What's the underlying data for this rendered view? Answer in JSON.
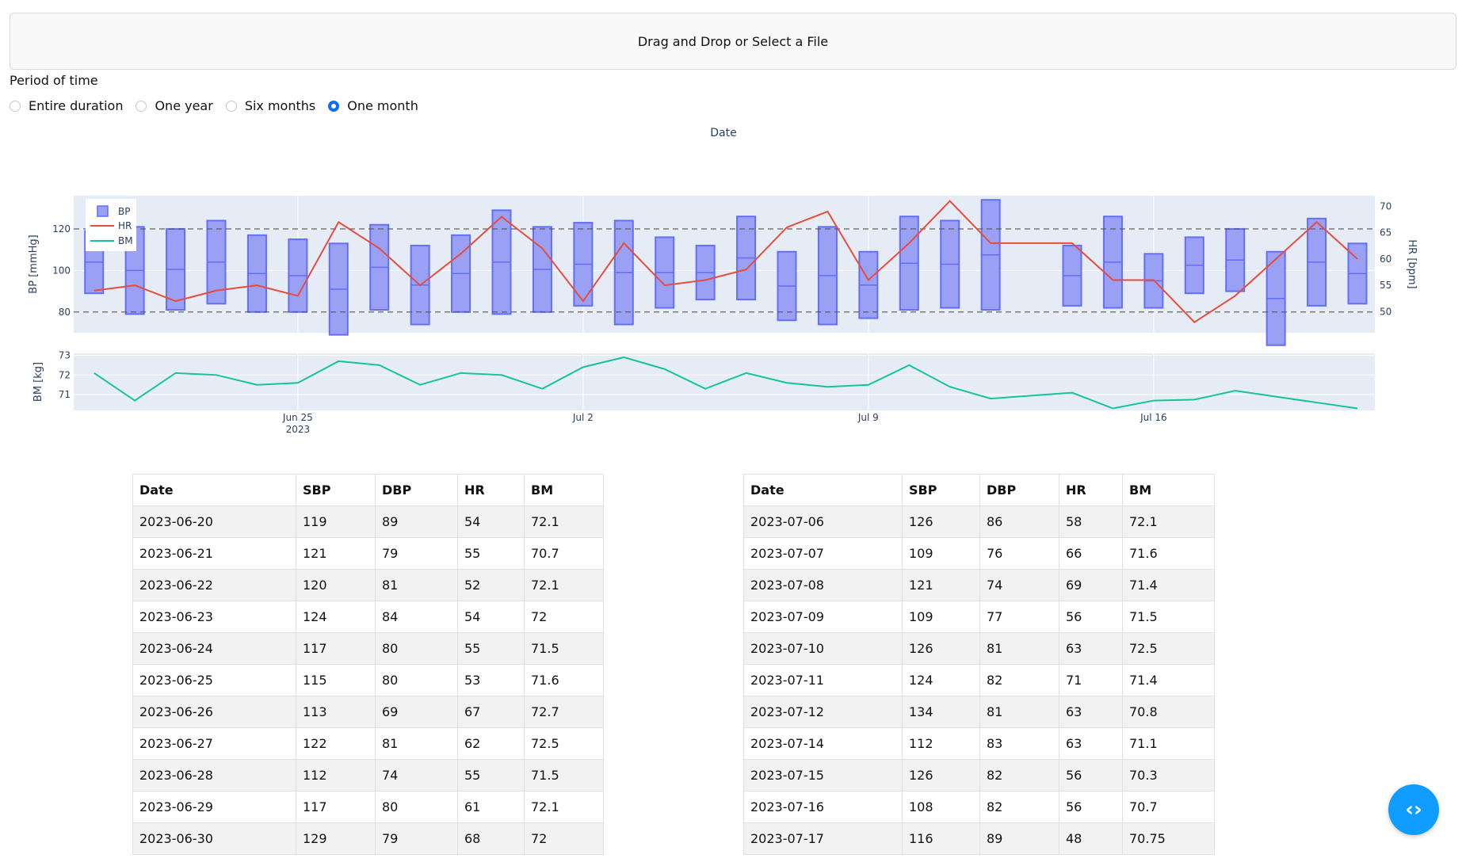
{
  "upload": {
    "label": "Drag and Drop or Select a File"
  },
  "period": {
    "label": "Period of time",
    "options": [
      "Entire duration",
      "One year",
      "Six months",
      "One month"
    ],
    "selected": "One month"
  },
  "chart_data": {
    "type": "mixed",
    "title": "Date",
    "legend": {
      "entries": [
        "BP",
        "HR",
        "BM"
      ],
      "placement": "top-left"
    },
    "top_panel": {
      "y_left": {
        "label": "BP [mmHg]",
        "range": [
          70,
          136
        ],
        "ticks": [
          80,
          100,
          120
        ]
      },
      "y_right": {
        "label": "HR [bpm]",
        "range": [
          46,
          72
        ],
        "ticks": [
          50,
          55,
          60,
          65,
          70
        ]
      },
      "reference_lines": [
        80,
        120
      ],
      "series": [
        {
          "name": "BP",
          "kind": "range-bars"
        },
        {
          "name": "HR",
          "kind": "line",
          "color": "#e74c3c"
        }
      ]
    },
    "bottom_panel": {
      "y": {
        "label": "BM [kg]",
        "range": [
          70.2,
          73.1
        ],
        "ticks": [
          71,
          72,
          73
        ]
      },
      "series": [
        {
          "name": "BM",
          "kind": "line",
          "color": "#17c39a"
        }
      ]
    },
    "x_axis": {
      "ticks": [
        {
          "date": "2023-06-25",
          "label": "Jun 25",
          "sub": "2023"
        },
        {
          "date": "2023-07-02",
          "label": "Jul 2",
          "sub": ""
        },
        {
          "date": "2023-07-09",
          "label": "Jul 9",
          "sub": ""
        },
        {
          "date": "2023-07-16",
          "label": "Jul 16",
          "sub": ""
        }
      ]
    },
    "points": [
      {
        "date": "2023-06-20",
        "sbp": 119,
        "dbp": 89,
        "hr": 54,
        "bm": 72.1
      },
      {
        "date": "2023-06-21",
        "sbp": 121,
        "dbp": 79,
        "hr": 55,
        "bm": 70.7
      },
      {
        "date": "2023-06-22",
        "sbp": 120,
        "dbp": 81,
        "hr": 52,
        "bm": 72.1
      },
      {
        "date": "2023-06-23",
        "sbp": 124,
        "dbp": 84,
        "hr": 54,
        "bm": 72
      },
      {
        "date": "2023-06-24",
        "sbp": 117,
        "dbp": 80,
        "hr": 55,
        "bm": 71.5
      },
      {
        "date": "2023-06-25",
        "sbp": 115,
        "dbp": 80,
        "hr": 53,
        "bm": 71.6
      },
      {
        "date": "2023-06-26",
        "sbp": 113,
        "dbp": 69,
        "hr": 67,
        "bm": 72.7
      },
      {
        "date": "2023-06-27",
        "sbp": 122,
        "dbp": 81,
        "hr": 62,
        "bm": 72.5
      },
      {
        "date": "2023-06-28",
        "sbp": 112,
        "dbp": 74,
        "hr": 55,
        "bm": 71.5
      },
      {
        "date": "2023-06-29",
        "sbp": 117,
        "dbp": 80,
        "hr": 61,
        "bm": 72.1
      },
      {
        "date": "2023-06-30",
        "sbp": 129,
        "dbp": 79,
        "hr": 68,
        "bm": 72
      },
      {
        "date": "2023-07-01",
        "sbp": 121,
        "dbp": 80,
        "hr": 62,
        "bm": 71.3
      },
      {
        "date": "2023-07-02",
        "sbp": 123,
        "dbp": 83,
        "hr": 52,
        "bm": 72.4
      },
      {
        "date": "2023-07-03",
        "sbp": 124,
        "dbp": 74,
        "hr": 63,
        "bm": 72.9
      },
      {
        "date": "2023-07-04",
        "sbp": 116,
        "dbp": 82,
        "hr": 55,
        "bm": 72.3
      },
      {
        "date": "2023-07-05",
        "sbp": 112,
        "dbp": 86,
        "hr": 56,
        "bm": 71.3
      },
      {
        "date": "2023-07-06",
        "sbp": 126,
        "dbp": 86,
        "hr": 58,
        "bm": 72.1
      },
      {
        "date": "2023-07-07",
        "sbp": 109,
        "dbp": 76,
        "hr": 66,
        "bm": 71.6
      },
      {
        "date": "2023-07-08",
        "sbp": 121,
        "dbp": 74,
        "hr": 69,
        "bm": 71.4
      },
      {
        "date": "2023-07-09",
        "sbp": 109,
        "dbp": 77,
        "hr": 56,
        "bm": 71.5
      },
      {
        "date": "2023-07-10",
        "sbp": 126,
        "dbp": 81,
        "hr": 63,
        "bm": 72.5
      },
      {
        "date": "2023-07-11",
        "sbp": 124,
        "dbp": 82,
        "hr": 71,
        "bm": 71.4
      },
      {
        "date": "2023-07-12",
        "sbp": 134,
        "dbp": 81,
        "hr": 63,
        "bm": 70.8
      },
      {
        "date": "2023-07-14",
        "sbp": 112,
        "dbp": 83,
        "hr": 63,
        "bm": 71.1
      },
      {
        "date": "2023-07-15",
        "sbp": 126,
        "dbp": 82,
        "hr": 56,
        "bm": 70.3
      },
      {
        "date": "2023-07-16",
        "sbp": 108,
        "dbp": 82,
        "hr": 56,
        "bm": 70.7
      },
      {
        "date": "2023-07-17",
        "sbp": 116,
        "dbp": 89,
        "hr": 48,
        "bm": 70.75
      },
      {
        "date": "2023-07-18",
        "sbp": 120,
        "dbp": 90,
        "hr": 53,
        "bm": 71.2
      },
      {
        "date": "2023-07-19",
        "sbp": 109,
        "dbp": 64,
        "hr": 60,
        "bm": 70.9
      },
      {
        "date": "2023-07-20",
        "sbp": 125,
        "dbp": 83,
        "hr": 67,
        "bm": 70.6
      },
      {
        "date": "2023-07-21",
        "sbp": 113,
        "dbp": 84,
        "hr": 60,
        "bm": 70.3
      }
    ]
  },
  "tables": [
    {
      "headers": [
        "Date",
        "SBP",
        "DBP",
        "HR",
        "BM"
      ],
      "rows": [
        [
          "2023-06-20",
          "119",
          "89",
          "54",
          "72.1"
        ],
        [
          "2023-06-21",
          "121",
          "79",
          "55",
          "70.7"
        ],
        [
          "2023-06-22",
          "120",
          "81",
          "52",
          "72.1"
        ],
        [
          "2023-06-23",
          "124",
          "84",
          "54",
          "72"
        ],
        [
          "2023-06-24",
          "117",
          "80",
          "55",
          "71.5"
        ],
        [
          "2023-06-25",
          "115",
          "80",
          "53",
          "71.6"
        ],
        [
          "2023-06-26",
          "113",
          "69",
          "67",
          "72.7"
        ],
        [
          "2023-06-27",
          "122",
          "81",
          "62",
          "72.5"
        ],
        [
          "2023-06-28",
          "112",
          "74",
          "55",
          "71.5"
        ],
        [
          "2023-06-29",
          "117",
          "80",
          "61",
          "72.1"
        ],
        [
          "2023-06-30",
          "129",
          "79",
          "68",
          "72"
        ]
      ]
    },
    {
      "headers": [
        "Date",
        "SBP",
        "DBP",
        "HR",
        "BM"
      ],
      "rows": [
        [
          "2023-07-06",
          "126",
          "86",
          "58",
          "72.1"
        ],
        [
          "2023-07-07",
          "109",
          "76",
          "66",
          "71.6"
        ],
        [
          "2023-07-08",
          "121",
          "74",
          "69",
          "71.4"
        ],
        [
          "2023-07-09",
          "109",
          "77",
          "56",
          "71.5"
        ],
        [
          "2023-07-10",
          "126",
          "81",
          "63",
          "72.5"
        ],
        [
          "2023-07-11",
          "124",
          "82",
          "71",
          "71.4"
        ],
        [
          "2023-07-12",
          "134",
          "81",
          "63",
          "70.8"
        ],
        [
          "2023-07-14",
          "112",
          "83",
          "63",
          "71.1"
        ],
        [
          "2023-07-15",
          "126",
          "82",
          "56",
          "70.3"
        ],
        [
          "2023-07-16",
          "108",
          "82",
          "56",
          "70.7"
        ],
        [
          "2023-07-17",
          "116",
          "89",
          "48",
          "70.75"
        ]
      ]
    }
  ],
  "fab": {
    "icon": "code-icon",
    "color": "#119dff"
  }
}
